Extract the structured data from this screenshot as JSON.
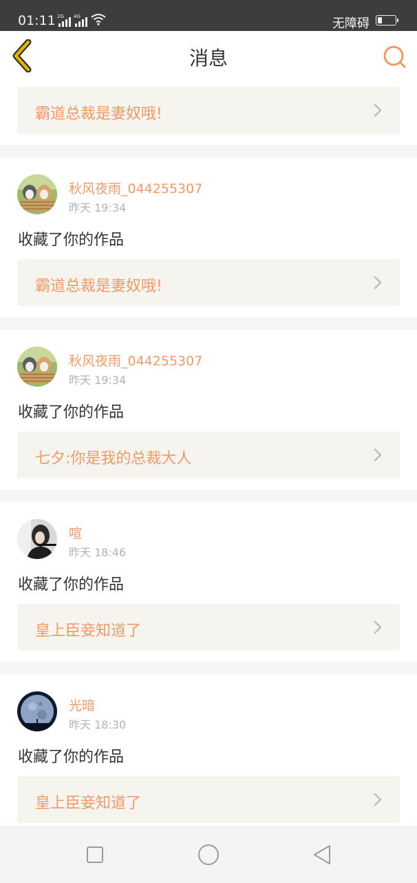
{
  "status_bar": {
    "time": "01:11",
    "sim1_label": "2G",
    "sim2_label": "4G",
    "accessibility_text": "无障碍",
    "icons": [
      "signal-icon",
      "wifi-icon",
      "battery-icon"
    ]
  },
  "header": {
    "title": "消息",
    "back_icon": "chevron-left-icon",
    "search_icon": "search-icon"
  },
  "colors": {
    "accent": "#f29a66",
    "back_icon": "#e6b400",
    "status_bar": "#3d3d3d",
    "card_link_bg": "#f5f4ef",
    "separator": "#f6f5f5"
  },
  "messages": [
    {
      "work_title": "霸道总裁是妻奴哦!"
    },
    {
      "user": "秋风夜雨_044255307",
      "time": "昨天 19:34",
      "action": "收藏了你的作品",
      "work_title": "霸道总裁是妻奴哦!"
    },
    {
      "user": "秋风夜雨_044255307",
      "time": "昨天 19:34",
      "action": "收藏了你的作品",
      "work_title": "七夕:你是我的总裁大人"
    },
    {
      "user": "喧",
      "time": "昨天 18:46",
      "action": "收藏了你的作品",
      "work_title": "皇上臣妾知道了"
    },
    {
      "user": "光暗",
      "time": "昨天 18:30",
      "action": "收藏了你的作品",
      "work_title": "皇上臣妾知道了"
    }
  ],
  "system_nav": [
    "square-icon",
    "circle-icon",
    "triangle-back-icon"
  ]
}
